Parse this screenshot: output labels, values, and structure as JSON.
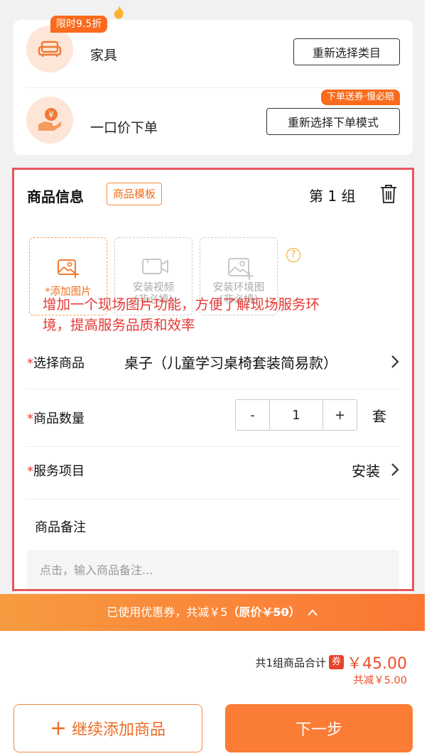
{
  "category_card": {
    "discount_tag": "限时9.5折",
    "category_name": "家具",
    "reselect_category_label": "重新选择类目",
    "promo_tag": "下单送券·慢必赔",
    "order_mode": "一口价下单",
    "reselect_mode_label": "重新选择下单模式"
  },
  "product_info": {
    "section_title": "商品信息",
    "template_tag": "商品模板",
    "group_label": "第 1 组",
    "uploads": [
      {
        "label": "*添加图片"
      },
      {
        "label_line1": "安装视频",
        "label_line2": "(非必填)"
      },
      {
        "label_line1": "安装环境图",
        "label_line2": "(非必填)"
      }
    ],
    "help_glyph": "?",
    "select_product_label": "选择商品",
    "select_product_value": "桌子（儿童学习桌椅套装简易款）",
    "quantity_label": "商品数量",
    "quantity_value": "1",
    "quantity_minus": "-",
    "quantity_plus": "+",
    "quantity_unit": "套",
    "service_label": "服务项目",
    "service_value": "安装",
    "annotation": "增加一个现场图片功能，方便了解现场服务环境，提高服务品质和效率",
    "note_label": "商品备注",
    "note_placeholder": "点击，输入商品备注..."
  },
  "coupon_bar": {
    "text_prefix": "已使用优惠券，共减￥5",
    "original_price_label": "（原价",
    "original_price": "￥50",
    "text_suffix": "）"
  },
  "summary": {
    "total_label": "共1组商品合计",
    "ticket_badge": "券",
    "total_amount": "￥45.00",
    "saved_text": "共减￥5.00"
  },
  "actions": {
    "continue_label": "继续添加商品",
    "next_label": "下一步"
  },
  "colors": {
    "accent": "#fb7c34",
    "annotation_red": "#e53935",
    "frame_red": "#e5565e"
  }
}
